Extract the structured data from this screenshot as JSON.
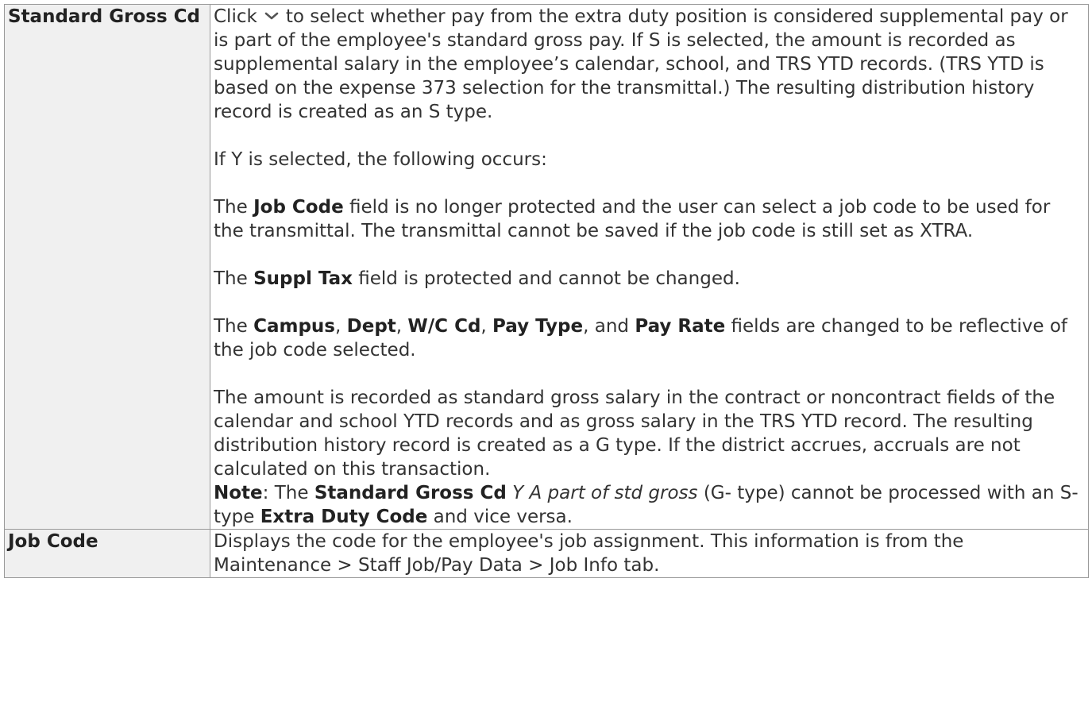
{
  "rows": [
    {
      "field": "Standard Gross Cd",
      "intro_before_icon": "Click",
      "icon": "chevron-down-icon",
      "intro_after_icon": "to select whether pay from the extra duty position is considered supplemental pay or is part of the employee's standard gross pay. If S is selected, the amount is recorded as supplemental salary in the employee’s calendar, school, and TRS YTD records. (TRS YTD is based on the expense 373 selection for the transmittal.) The resulting distribution history record is created as an S type.",
      "y_selected": "If Y is selected, the following occurs:",
      "job_code_para": {
        "pre": "The",
        "bold": "Job Code",
        "post": "field is no longer protected and the user can select a job code to be used for the transmittal. The transmittal cannot be saved if the job code is still set as XTRA."
      },
      "suppl_tax_para": {
        "pre": "The",
        "bold": "Suppl Tax",
        "post": "field is protected and cannot be changed."
      },
      "fields_para": {
        "pre": "The",
        "campus": "Campus",
        "dept": "Dept",
        "wc": "W/C Cd",
        "pay_type": "Pay Type",
        "and": ", and",
        "pay_rate": "Pay Rate",
        "post": "fields are changed to be reflective of the job code selected."
      },
      "amount_para": "The amount is recorded as standard gross salary in the contract or noncontract fields of the calendar and school YTD records and as gross salary in the TRS YTD record. The resulting distribution history record is created as a G type. If the district accrues, accruals are not calculated on this transaction.",
      "note": {
        "label": "Note",
        "colon": ": The",
        "bold1": "Standard Gross Cd",
        "italic": "Y A part of std gross",
        "mid": "(G- type) cannot be processed with an S-type",
        "bold2": "Extra Duty Code",
        "post": "and vice versa."
      }
    },
    {
      "field": "Job Code",
      "desc": "Displays the code for the employee's job assignment. This information is from the Maintenance > Staff Job/Pay Data > Job Info tab."
    }
  ]
}
